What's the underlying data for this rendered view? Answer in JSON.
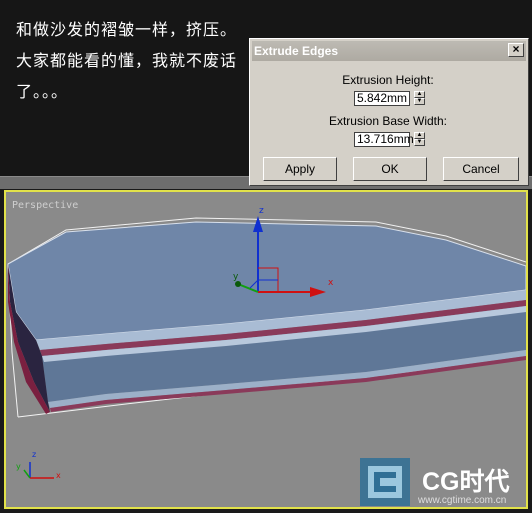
{
  "caption": {
    "line1": "和做沙发的褶皱一样，挤压。",
    "line2": "大家都能看的懂，我就不废话",
    "line3": "了。。。"
  },
  "dialog": {
    "title": "Extrude Edges",
    "close": "×",
    "height_label": "Extrusion Height:",
    "height_value": "5.842mm",
    "width_label": "Extrusion Base Width:",
    "width_value": "13.716mm",
    "apply": "Apply",
    "ok": "OK",
    "cancel": "Cancel"
  },
  "viewport": {
    "label": "Perspective",
    "gizmo": {
      "x": "x",
      "y": "y",
      "z": "z"
    },
    "axes": {
      "x": "x",
      "y": "y",
      "z": "z"
    }
  },
  "watermark": {
    "brand": "CG时代",
    "url": "www.cgtime.com.cn"
  },
  "colors": {
    "viewport_border": "#e2e24a",
    "model_top": "#6f86a8",
    "model_side": "#5a7090",
    "groove": "#a04060"
  }
}
